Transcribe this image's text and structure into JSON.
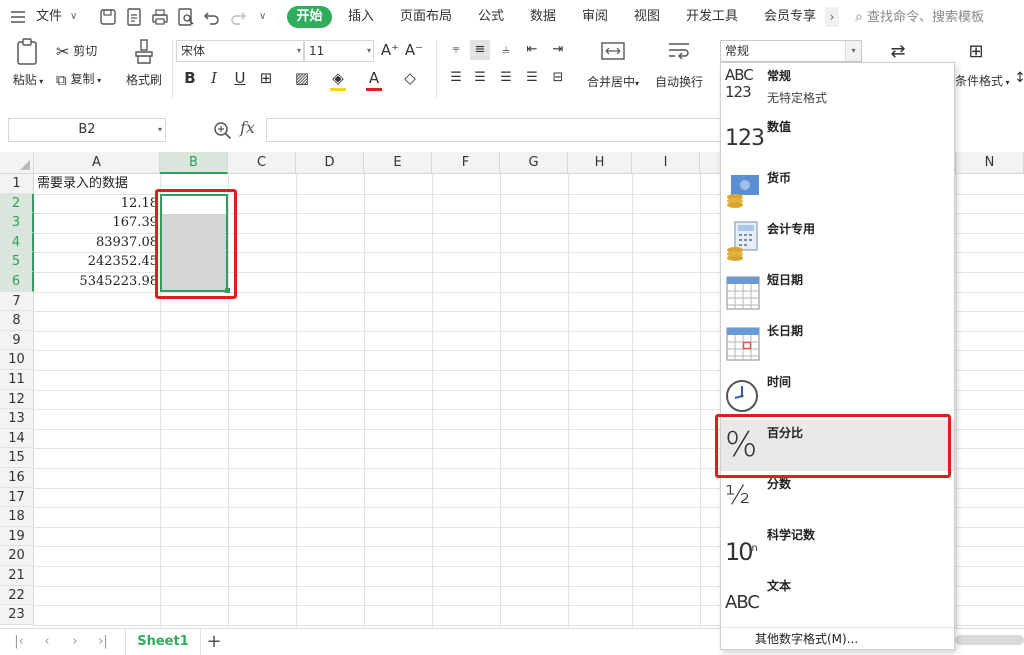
{
  "menubar": {
    "file_label": "文件",
    "tabs": [
      "开始",
      "插入",
      "页面布局",
      "公式",
      "数据",
      "审阅",
      "视图",
      "开发工具",
      "会员专享"
    ],
    "more_label": "›",
    "search_placeholder": "查找命令、搜索模板"
  },
  "ribbon": {
    "paste": "粘贴",
    "cut": "剪切",
    "copy": "复制",
    "format_painter": "格式刷",
    "font_name": "宋体",
    "font_size": "11",
    "merge_center": "合并居中",
    "auto_wrap": "自动换行",
    "conditional_format": "条件格式"
  },
  "formula_bar": {
    "name_box": "B2",
    "fx": "fx",
    "formula": ""
  },
  "grid": {
    "columns": [
      "A",
      "B",
      "C",
      "D",
      "E",
      "F",
      "G",
      "H",
      "I",
      "N"
    ],
    "selected_column": "B",
    "rows": [
      "1",
      "2",
      "3",
      "4",
      "5",
      "6",
      "7",
      "8",
      "9",
      "10",
      "11",
      "12",
      "13",
      "14",
      "15",
      "16",
      "17",
      "18",
      "19",
      "20",
      "21",
      "22",
      "23"
    ],
    "selected_rows": [
      "2",
      "3",
      "4",
      "5",
      "6"
    ],
    "A1": "需要录入的数据",
    "A_values": [
      "12.18",
      "167.39",
      "83937.08",
      "242352.45",
      "5345223.98"
    ]
  },
  "sheet_tabs": {
    "active": "Sheet1",
    "add": "+"
  },
  "number_format": {
    "current": "常规",
    "items": [
      {
        "label": "常规",
        "sub": "无特定格式",
        "icon": "abc-123-icon"
      },
      {
        "label": "数值",
        "sub": "",
        "icon": "number-123-icon"
      },
      {
        "label": "货币",
        "sub": "",
        "icon": "currency-icon"
      },
      {
        "label": "会计专用",
        "sub": "",
        "icon": "accounting-icon"
      },
      {
        "label": "短日期",
        "sub": "",
        "icon": "short-date-icon"
      },
      {
        "label": "长日期",
        "sub": "",
        "icon": "long-date-icon"
      },
      {
        "label": "时间",
        "sub": "",
        "icon": "clock-icon"
      },
      {
        "label": "百分比",
        "sub": "",
        "icon": "percent-icon"
      },
      {
        "label": "分数",
        "sub": "",
        "icon": "fraction-icon"
      },
      {
        "label": "科学记数",
        "sub": "",
        "icon": "scientific-icon"
      },
      {
        "label": "文本",
        "sub": "",
        "icon": "text-abc-icon"
      }
    ],
    "highlighted": "百分比",
    "more": "其他数字格式(M)..."
  },
  "colors": {
    "accent_green": "#2fad5d",
    "highlight_red": "#e11d1d",
    "selection_fill": "#d6d6d6"
  }
}
